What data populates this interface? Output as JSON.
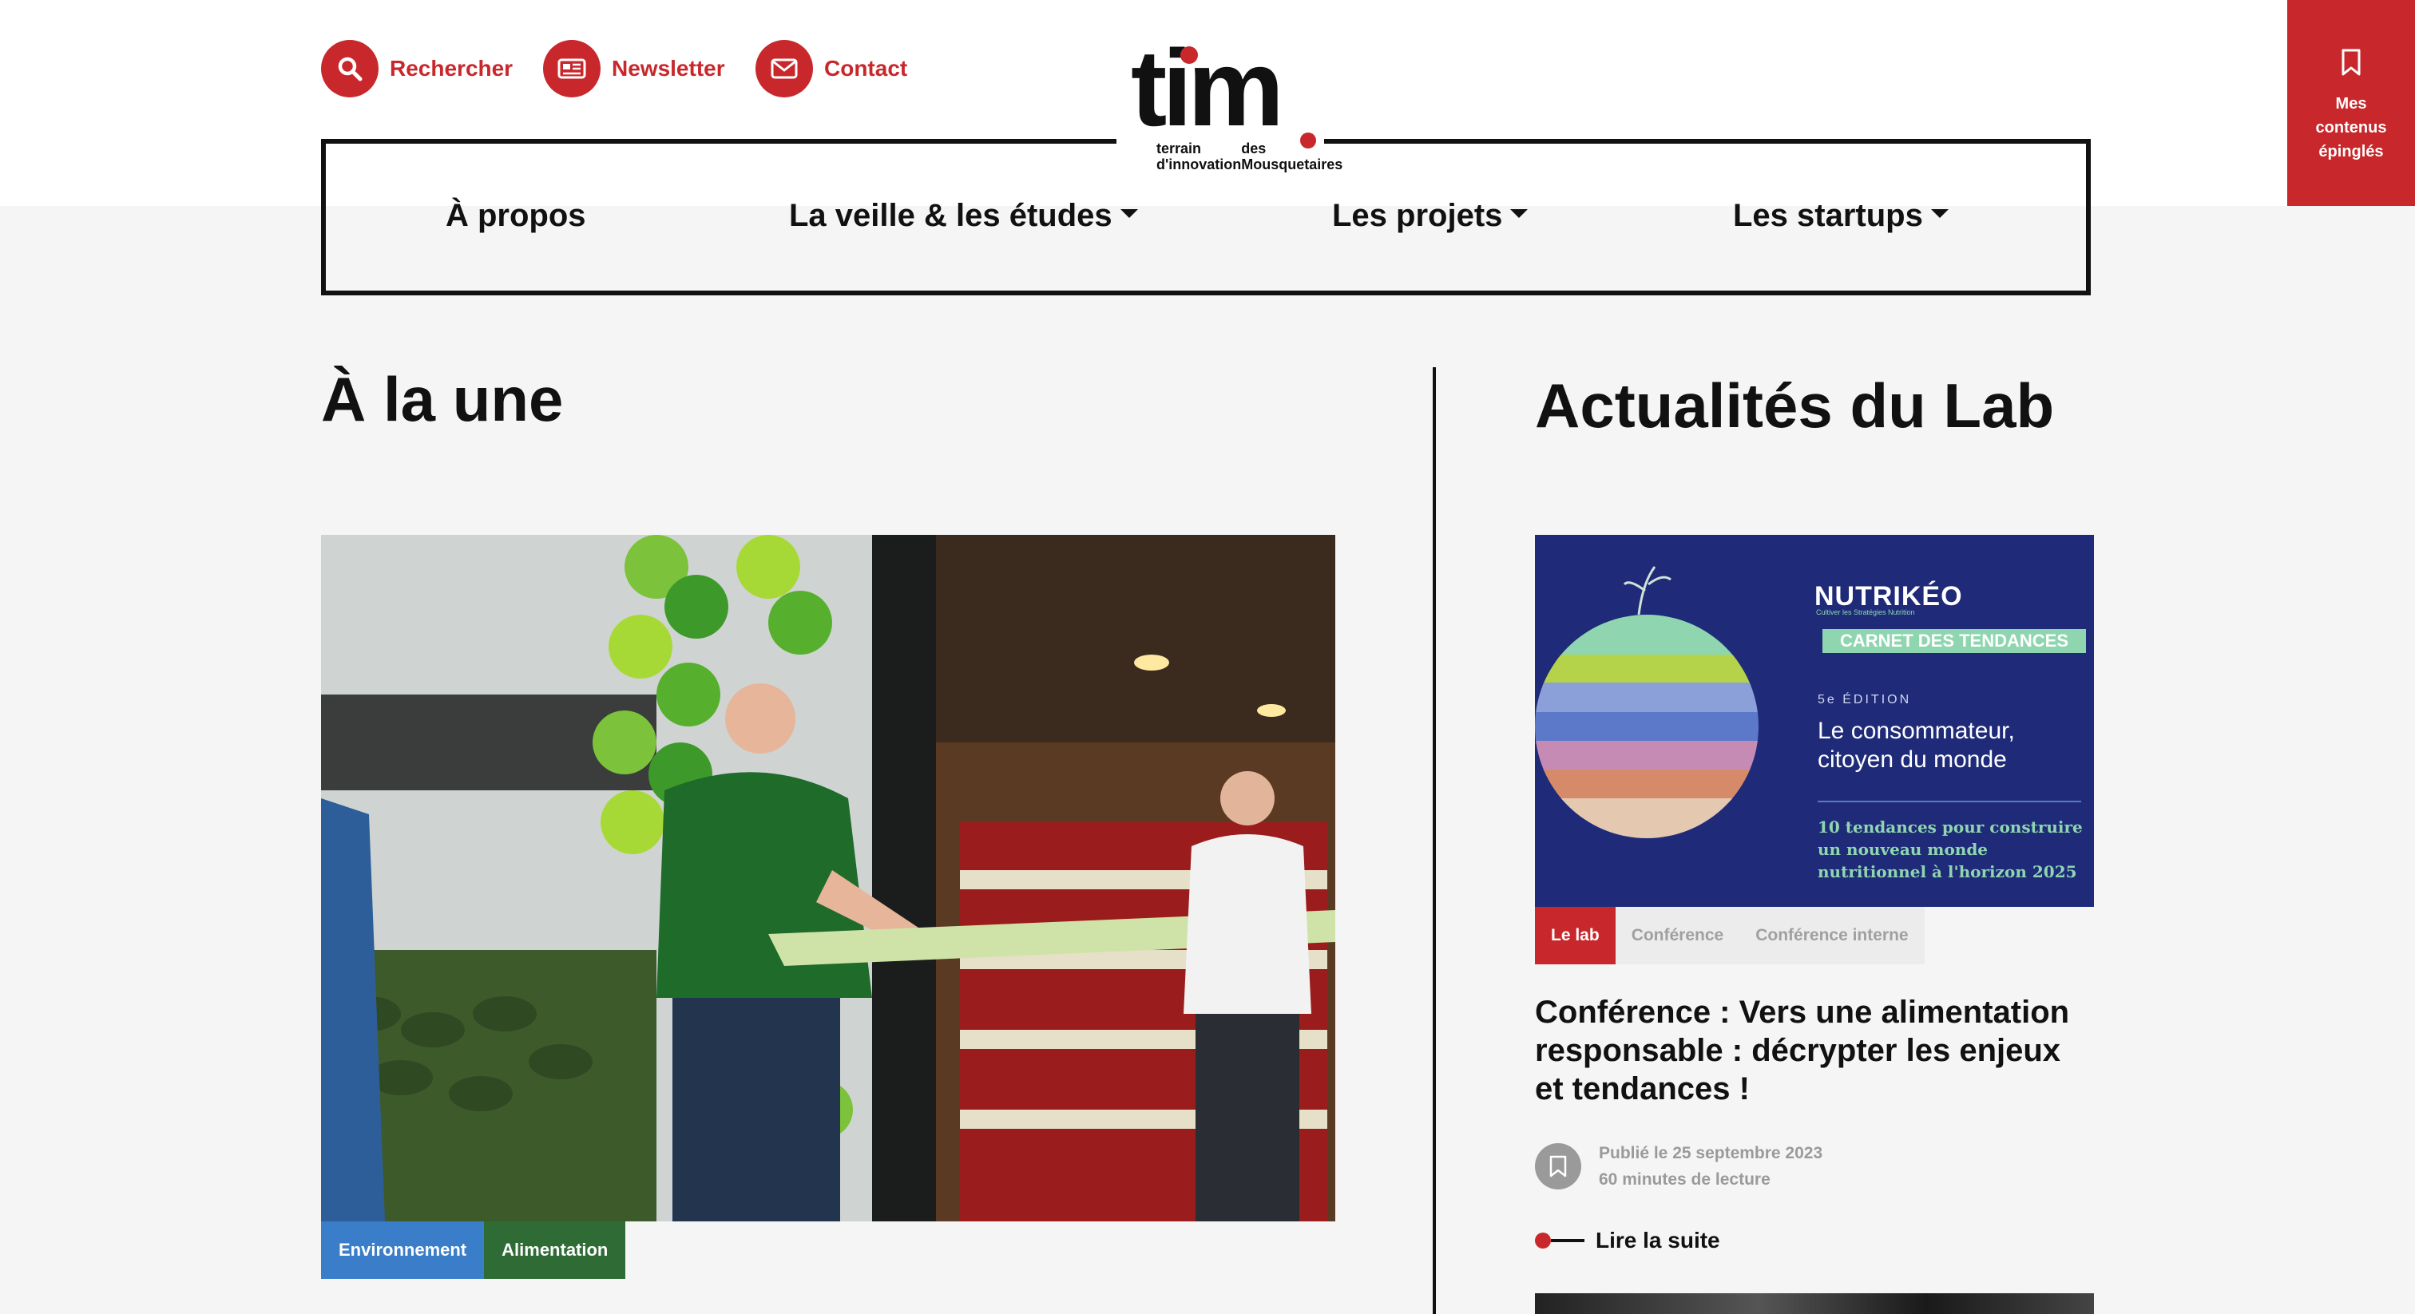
{
  "top_links": {
    "search": {
      "label": "Rechercher",
      "icon": "search-icon"
    },
    "newsletter": {
      "label": "Newsletter",
      "icon": "newspaper-icon"
    },
    "contact": {
      "label": "Contact",
      "icon": "envelope-icon"
    }
  },
  "pinned": {
    "label": "Mes contenus épinglés",
    "icon": "bookmark-icon"
  },
  "logo": {
    "word": "tim",
    "tagline_1": "terrain d'innovation",
    "tagline_2": "des Mousquetaires"
  },
  "nav": {
    "items": [
      {
        "label": "À propos",
        "has_dropdown": false
      },
      {
        "label": "La veille & les études",
        "has_dropdown": true
      },
      {
        "label": "Les projets",
        "has_dropdown": true
      },
      {
        "label": "Les startups",
        "has_dropdown": true
      }
    ]
  },
  "une": {
    "heading": "À la une",
    "tags": [
      "Environnement",
      "Alimentation"
    ]
  },
  "lab": {
    "heading": "Actualités du Lab",
    "card_image": {
      "brand": "NUTRIKÉO",
      "brand_sub": "Cultiver les Stratégies Nutrition",
      "banner": "CARNET DES TENDANCES",
      "edition": "5e ÉDITION",
      "headline_1": "Le consommateur,",
      "headline_2": "citoyen du monde",
      "sub_1": "10 tendances pour construire",
      "sub_2": "un nouveau monde",
      "sub_3": "nutritionnel à l'horizon 2025"
    },
    "tags": [
      "Le lab",
      "Conférence",
      "Conférence interne"
    ],
    "title": "Conférence : Vers une alimentation responsable : décrypter les enjeux et tendances !",
    "published": "Publié le 25 septembre 2023",
    "reading_time": "60 minutes de lecture",
    "read_more": "Lire la suite"
  },
  "colors": {
    "brand_red": "#c8282c",
    "tag_blue": "#3a7dc9",
    "tag_green": "#2e6b35",
    "card_navy": "#1f2b78",
    "banner_green": "#8fd6b0"
  }
}
